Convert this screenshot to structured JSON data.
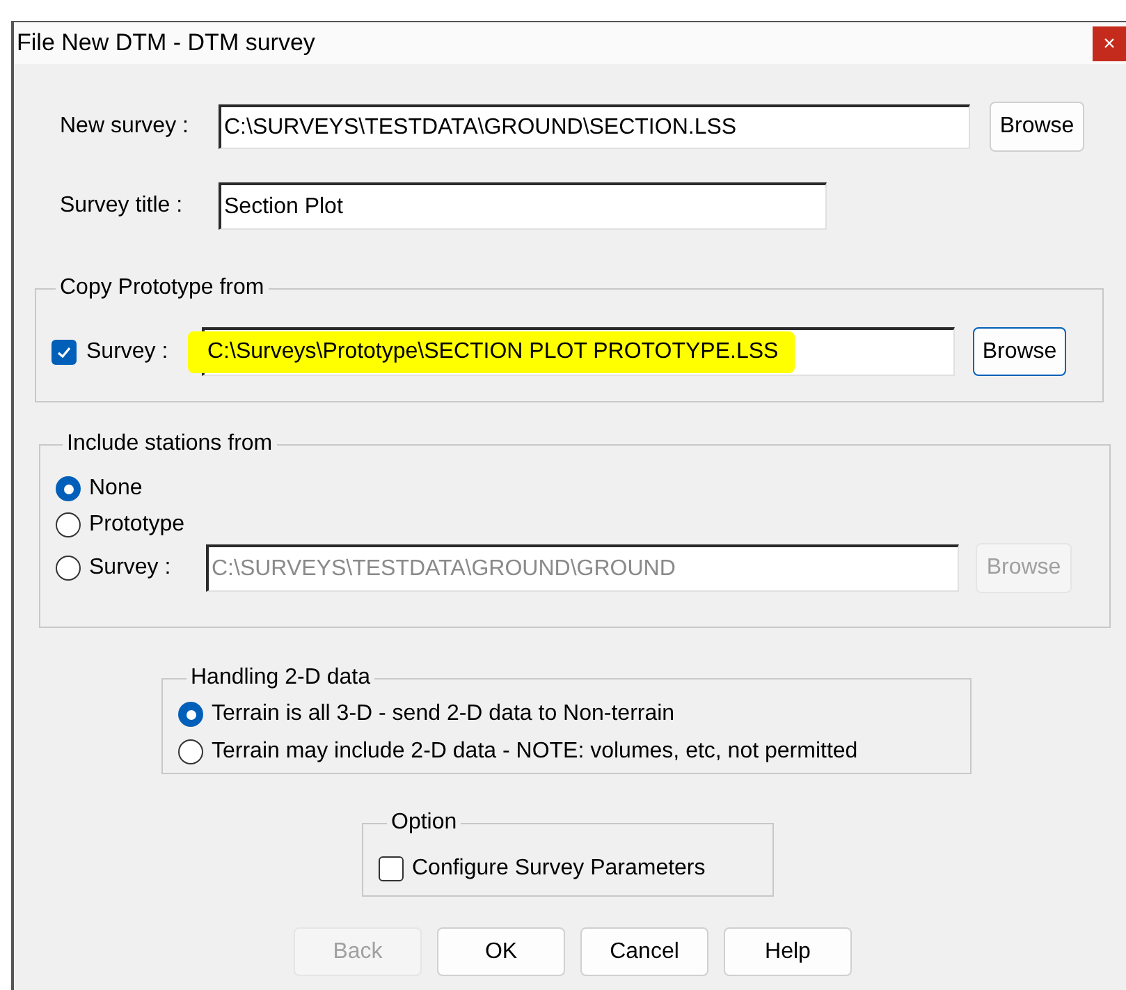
{
  "window": {
    "title": "File New DTM - DTM survey",
    "close": "×"
  },
  "new_survey": {
    "label": "New survey :",
    "value": "C:\\SURVEYS\\TESTDATA\\GROUND\\SECTION.LSS",
    "button": "Browse"
  },
  "survey_title": {
    "label": "Survey title :",
    "value": "Section Plot"
  },
  "copy_prototype": {
    "legend": "Copy Prototype from",
    "checkbox": {
      "label": "Survey :",
      "checked": true
    },
    "value": "C:\\Surveys\\Prototype\\SECTION PLOT PROTOTYPE.LSS",
    "highlighted": true,
    "button": "Browse"
  },
  "include_stations": {
    "legend": "Include stations from",
    "options": [
      {
        "label": "None",
        "selected": true
      },
      {
        "label": "Prototype",
        "selected": false
      },
      {
        "label": "Survey :",
        "selected": false
      }
    ],
    "survey_value": "C:\\SURVEYS\\TESTDATA\\GROUND\\GROUND",
    "disabled": true,
    "button": "Browse"
  },
  "handling_2d": {
    "legend": "Handling 2-D data",
    "options": [
      {
        "label": "Terrain is all 3-D - send 2-D data to Non-terrain",
        "selected": true
      },
      {
        "label": "Terrain may include 2-D data - NOTE: volumes, etc, not permitted",
        "selected": false
      }
    ]
  },
  "option": {
    "legend": "Option",
    "checkbox": {
      "label": "Configure Survey Parameters",
      "checked": false
    }
  },
  "buttons": [
    {
      "label": "Back",
      "disabled": true
    },
    {
      "label": "OK",
      "disabled": false
    },
    {
      "label": "Cancel",
      "disabled": false
    },
    {
      "label": "Help",
      "disabled": false
    }
  ]
}
